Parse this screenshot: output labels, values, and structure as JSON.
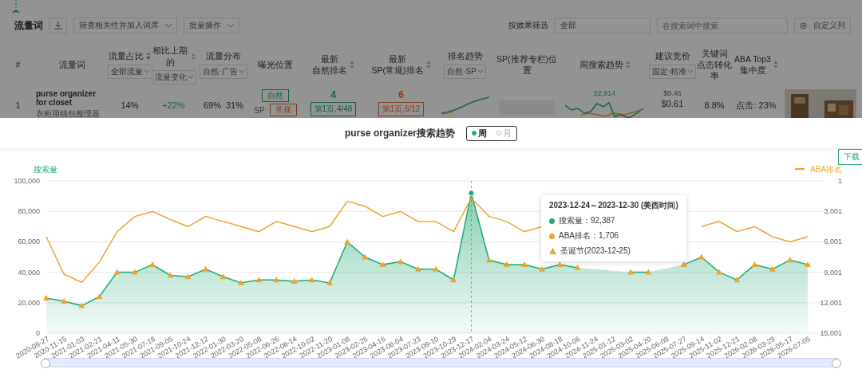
{
  "toolbar": {
    "title": "流量词",
    "relevance_select": "筛查相关性并加入词库",
    "batch_select": "批量操作",
    "filter_label": "按效果筛选",
    "filter_select": "全部",
    "search": {
      "placeholder": "在搜索词中搜索"
    },
    "custom_button": "自定义列"
  },
  "columns": [
    {
      "label": [
        "#"
      ]
    },
    {
      "label": [
        "流量词"
      ]
    },
    {
      "label": [
        "流量占比"
      ],
      "filter": "全部流量",
      "sorted": true
    },
    {
      "label": [
        "相比上期的"
      ],
      "filter": "流量变化",
      "sorted": false
    },
    {
      "label": [
        "流量分布"
      ],
      "filter": "自然·广告"
    },
    {
      "label": [
        "曝光位置"
      ]
    },
    {
      "label": [
        "最新",
        "自然排名"
      ],
      "sorted": false
    },
    {
      "label": [
        "最新",
        "SP(常规)排名"
      ],
      "sorted": false
    },
    {
      "label": [
        "排名趋势"
      ],
      "filter": "自然·SP"
    },
    {
      "label": [
        "SP(推荐专栏)位置"
      ]
    },
    {
      "label": [
        "周搜索趋势"
      ],
      "sorted": false
    },
    {
      "label": [
        "建议竞价"
      ],
      "filter": "固定·精准"
    },
    {
      "label": [
        "关键词",
        "点击转化率"
      ]
    },
    {
      "label": [
        "ABA Top3",
        "集中度"
      ],
      "sorted": false
    }
  ],
  "row": {
    "index": "1",
    "keyword": "purse organizer for closet",
    "translation": "衣柜用钱包整理器",
    "share": "14%",
    "change": "+22%",
    "natural_share": "69%",
    "ad_share": "31%",
    "exposure": {
      "natural_tag": "自然",
      "sp_label": "SP",
      "sp_tag": "常规"
    },
    "natural_rank": {
      "rank": "4",
      "page": "第1页,4/48"
    },
    "sp_rank": {
      "rank": "6",
      "page": "第1页,6/12"
    },
    "search_peak": "22,914",
    "bid_low": "$0.46",
    "bid": "$0.61",
    "conversion": "8.8%",
    "top3": "点击: 23%"
  },
  "modal": {
    "title": "purse organizer搜索趋势",
    "periods": [
      {
        "label": "周",
        "selected": true
      },
      {
        "label": "月",
        "selected": false
      }
    ],
    "download_button": "下载",
    "chart_data": {
      "type": "line",
      "grid": true,
      "ref_lines": [
        {
          "axis": "x",
          "value": "2023-12-17"
        }
      ],
      "categories": [
        "2020-09-27",
        "2020-11-15",
        "2021-01-03",
        "2021-02-21",
        "2021-04-11",
        "2021-05-30",
        "2021-07-18",
        "2021-09-05",
        "2021-10-24",
        "2021-12-12",
        "2022-01-30",
        "2022-03-20",
        "2022-05-08",
        "2022-06-26",
        "2022-08-14",
        "2022-10-02",
        "2022-11-20",
        "2023-01-08",
        "2023-02-26",
        "2023-04-16",
        "2023-06-04",
        "2023-07-23",
        "2023-09-10",
        "2023-10-29",
        "2023-12-17",
        "2024-02-04",
        "2024-03-24",
        "2024-05-12",
        "2024-06-30",
        "2024-08-18",
        "2024-10-06",
        "2024-11-24",
        "2025-01-12",
        "2025-03-02",
        "2025-04-20",
        "2025-06-08",
        "2025-07-27",
        "2025-09-14",
        "2025-11-02",
        "2025-12-21",
        "2026-02-08",
        "2026-03-29",
        "2026-05-17",
        "2026-07-05"
      ],
      "series": [
        {
          "name": "搜索量",
          "type": "area",
          "color": "#1fa971",
          "marker": "triangle",
          "values": [
            23000,
            21000,
            18000,
            24000,
            40000,
            40000,
            45000,
            38000,
            37000,
            42000,
            37000,
            33000,
            35000,
            35000,
            34000,
            35000,
            33000,
            60000,
            50000,
            45000,
            47000,
            42000,
            42000,
            35000,
            92000,
            48000,
            45000,
            45000,
            42000,
            45000,
            43000,
            null,
            null,
            40000,
            40000,
            null,
            45000,
            50000,
            40000,
            35000,
            45000,
            42000,
            48000,
            45000
          ]
        },
        {
          "name": "ABA排名",
          "type": "line",
          "color": "#f0a32e",
          "axis": "y2",
          "values": [
            5500,
            9200,
            10000,
            8000,
            5000,
            3500,
            3000,
            3800,
            4500,
            3500,
            4000,
            4500,
            5000,
            4000,
            4500,
            5000,
            4500,
            2000,
            2500,
            3500,
            3000,
            4000,
            4000,
            5000,
            1700,
            3500,
            4000,
            5000,
            4500,
            null,
            null,
            null,
            null,
            null,
            null,
            null,
            null,
            4500,
            4000,
            5000,
            4500,
            5500,
            6000,
            5500
          ]
        }
      ],
      "ylim": [
        0,
        100000
      ],
      "yticks": [
        {
          "value": 0,
          "label": "0"
        },
        {
          "value": 20000,
          "label": "20,000"
        },
        {
          "value": 40000,
          "label": "40,000"
        },
        {
          "value": 60000,
          "label": "60,000"
        },
        {
          "value": 80000,
          "label": "80,000"
        },
        {
          "value": 100000,
          "label": "100,000"
        }
      ],
      "y2lim": [
        15001,
        1
      ],
      "y2ticks": [
        {
          "value": 1,
          "label": "1"
        },
        {
          "value": 3001,
          "label": "3,001"
        },
        {
          "value": 6001,
          "label": "6,001"
        },
        {
          "value": 9001,
          "label": "9,001"
        },
        {
          "value": 12001,
          "label": "12,001"
        },
        {
          "value": 15001,
          "label": "15,001"
        }
      ]
    },
    "tooltip": {
      "title": "2023-12-24～2023-12-30 (美西时间)",
      "rows": [
        {
          "kind": "dot",
          "color": "#1fa971",
          "text": "搜索量：92,387"
        },
        {
          "kind": "dot",
          "color": "#f0a32e",
          "text": "ABA排名：1,706"
        },
        {
          "kind": "triangle",
          "color": "#f0a32e",
          "text": "圣诞节(2023-12-25)"
        }
      ]
    }
  }
}
